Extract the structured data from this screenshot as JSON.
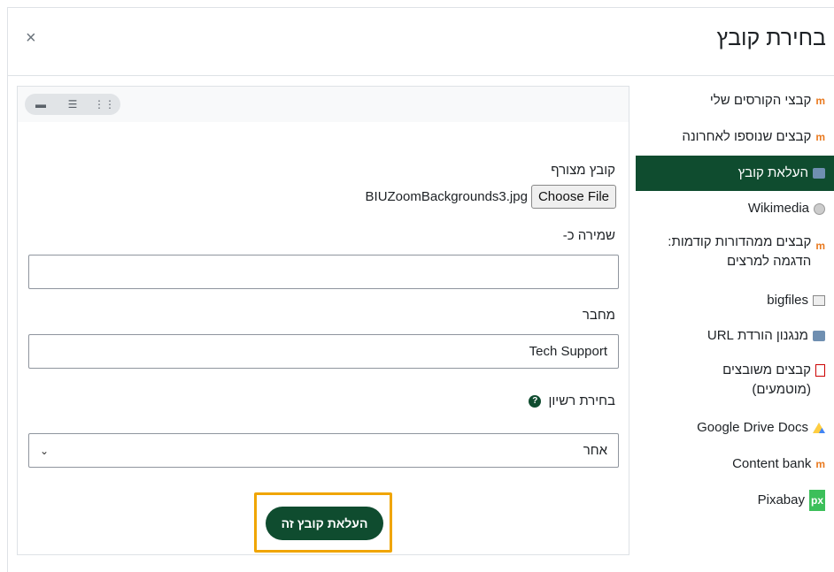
{
  "dialog": {
    "title": "בחירת קובץ",
    "close_label": "×"
  },
  "sidebar": {
    "items": [
      {
        "label": "קבצי הקורסים שלי",
        "icon": "moodle-icon"
      },
      {
        "label": "קבצים שנוספו לאחרונה",
        "icon": "moodle-icon"
      },
      {
        "label": "העלאת קובץ",
        "icon": "upload-icon",
        "active": true
      },
      {
        "label": "Wikimedia",
        "icon": "wikimedia-icon"
      },
      {
        "label": "קבצים ממהדורות קודמות: הדגמה למרצים",
        "icon": "moodle-icon"
      },
      {
        "label": "bigfiles",
        "icon": "folder-icon"
      },
      {
        "label": "מנגנון הורדת URL",
        "icon": "url-icon"
      },
      {
        "label": "קבצים משובצים (מוטמעים)",
        "icon": "pdf-icon"
      },
      {
        "label": "Google Drive Docs",
        "icon": "google-drive-icon"
      },
      {
        "label": "Content bank",
        "icon": "moodle-icon"
      },
      {
        "label": "Pixabay",
        "icon": "pixabay-icon"
      }
    ]
  },
  "toolbar": {
    "views": [
      "grid-icon",
      "list-icon",
      "folder-icon"
    ]
  },
  "form": {
    "attachment_label": "קובץ מצורף",
    "choose_file_label": "Choose File",
    "file_name": "BIUZoomBackgrounds3.jpg",
    "save_as_label": "שמירה כ-",
    "save_as_value": "",
    "author_label": "מחבר",
    "author_value": "Tech Support",
    "license_label": "בחירת רשיון",
    "license_value": "אחר",
    "upload_button": "העלאת קובץ זה"
  },
  "colors": {
    "brand": "#0f4c2f",
    "focus": "#f0a500"
  }
}
